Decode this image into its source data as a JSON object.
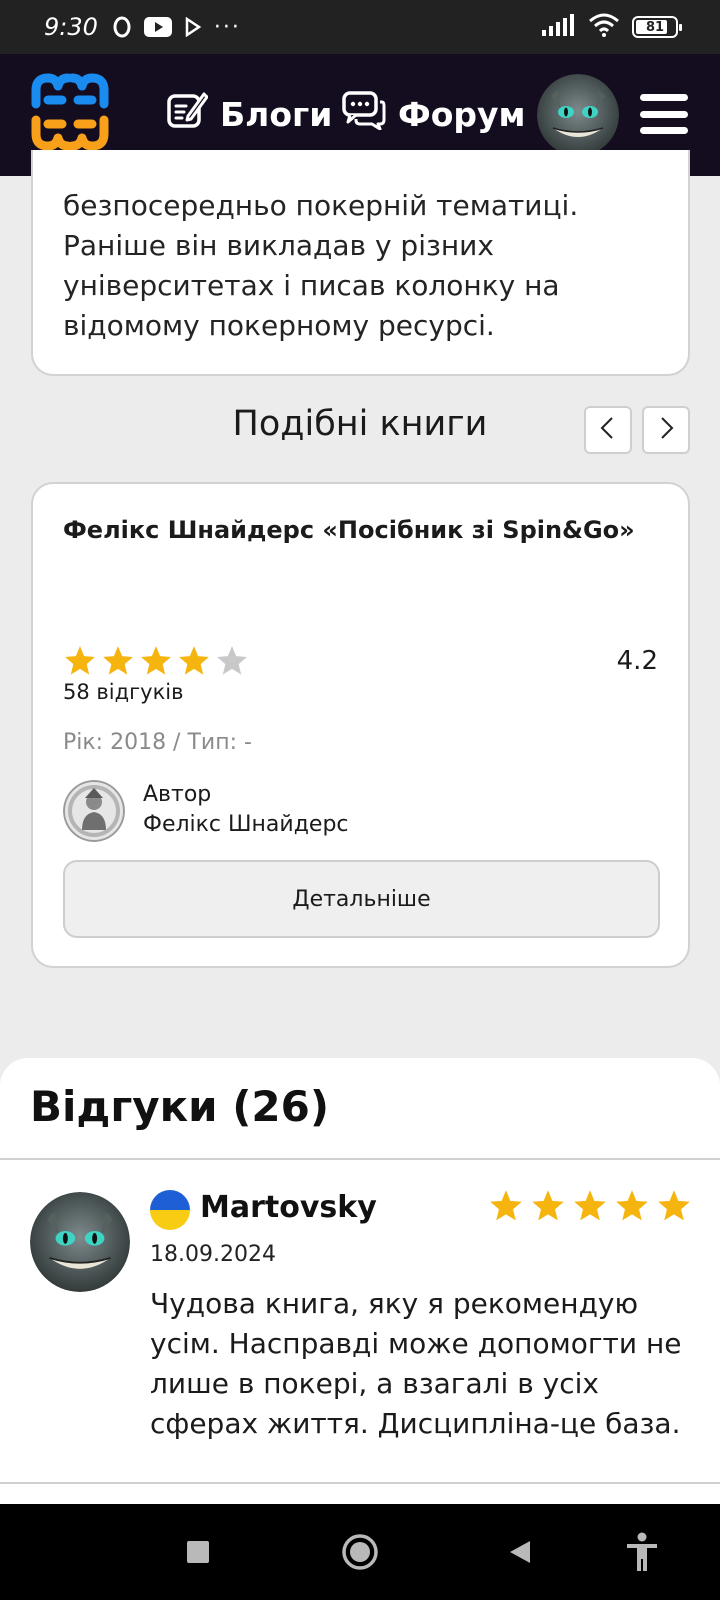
{
  "status_bar": {
    "time": "9:30",
    "battery": "81",
    "battery_level": 0.81
  },
  "nav": {
    "blogs_label": "Блоги",
    "forum_label": "Форум",
    "icons": [
      "logo-icon",
      "blog-icon",
      "forum-icon",
      "avatar",
      "menu-icon"
    ]
  },
  "bio": {
    "lines": [
      "безпосередньо покерній тематиці.",
      "Раніше він викладав у різних",
      "університетах і писав колонку на",
      "відомому покерному ресурсі."
    ]
  },
  "similar": {
    "title": "Подібні книги",
    "book": {
      "title": "Фелікс Шнайдерс «Посібник зі Spin&Go»",
      "stars_filled": 4,
      "stars_total": 5,
      "rating": "4.2",
      "reviews": "58 відгуків",
      "meta": "Рік: 2018 / Тип: -",
      "author_label": "Автор",
      "author_name": "Фелікс Шнайдерс",
      "details_label": "Детальніше"
    }
  },
  "reviews": {
    "heading": "Відгуки (26)",
    "items": [
      {
        "user": "Martovsky",
        "date": "18.09.2024",
        "stars": 5,
        "lines": [
          "Чудова книга, яку я рекомендую",
          "усім. Насправді може допомогти не",
          "лише в покері, а взагалі в усіх",
          "сферах життя. Дисципліна-це база."
        ]
      }
    ]
  },
  "colors": {
    "nav_bg": "#140c1f",
    "star_filled": "#f6b40e",
    "star_empty": "#c8c8c8",
    "logo_blue": "#1a8cf0",
    "logo_orange": "#f9a01b",
    "flag_blue": "#1f5fd6",
    "flag_yellow": "#f8cc13"
  }
}
